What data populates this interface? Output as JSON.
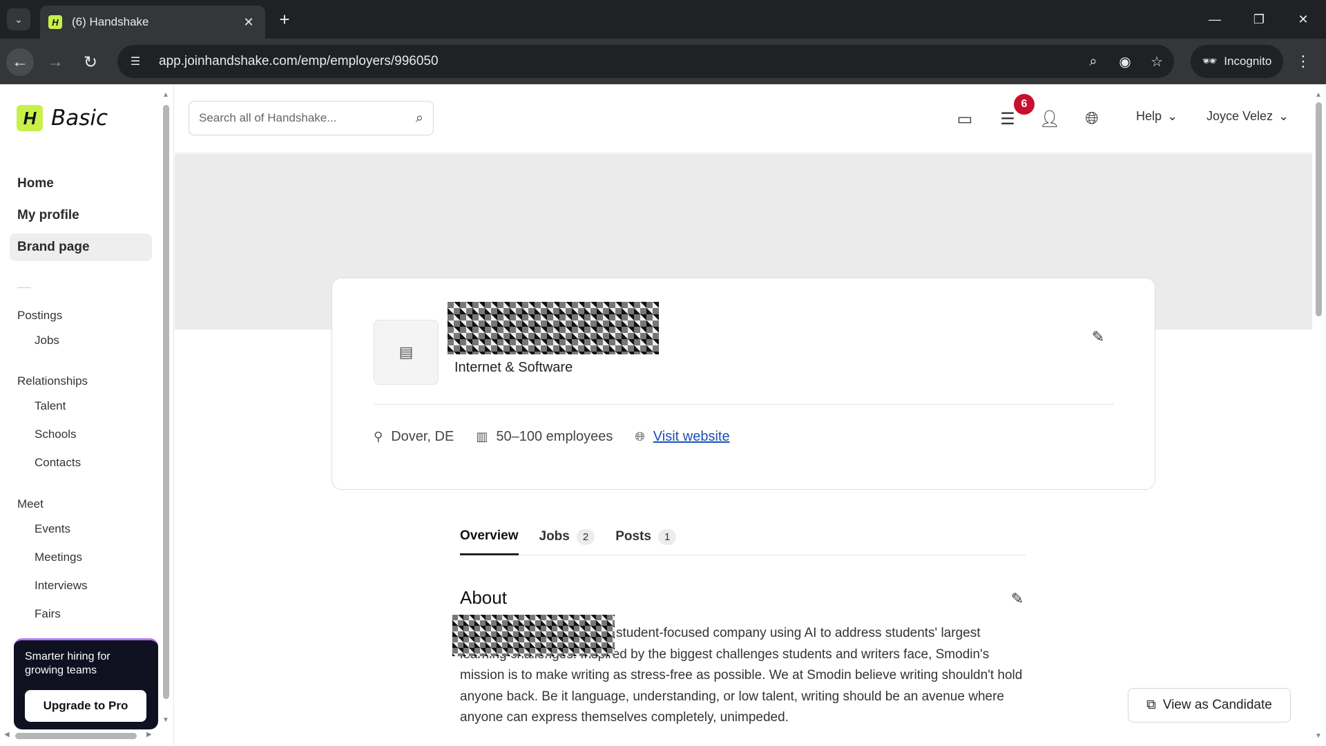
{
  "browser": {
    "tab_title": "(6) Handshake",
    "favicon_letter": "H",
    "url": "app.joinhandshake.com/emp/employers/996050",
    "incognito_label": "Incognito"
  },
  "sidebar": {
    "logo_letter": "H",
    "logo_text": "Basic",
    "main_items": [
      {
        "label": "Home"
      },
      {
        "label": "My profile"
      },
      {
        "label": "Brand page"
      }
    ],
    "groups": {
      "postings": {
        "title": "Postings",
        "items": [
          {
            "label": "Jobs"
          }
        ]
      },
      "relationships": {
        "title": "Relationships",
        "items": [
          {
            "label": "Talent"
          },
          {
            "label": "Schools"
          },
          {
            "label": "Contacts"
          }
        ]
      },
      "meet": {
        "title": "Meet",
        "items": [
          {
            "label": "Events"
          },
          {
            "label": "Meetings"
          },
          {
            "label": "Interviews"
          },
          {
            "label": "Fairs"
          }
        ]
      }
    },
    "promo": {
      "text": "Smarter hiring for growing teams",
      "button": "Upgrade to Pro"
    }
  },
  "topbar": {
    "search_placeholder": "Search all of Handshake...",
    "messages_badge": "6",
    "help_label": "Help",
    "user_name": "Joyce Velez"
  },
  "employer": {
    "industry": "Internet & Software",
    "location": "Dover, DE",
    "size": "50–100 employees",
    "website_label": "Visit website"
  },
  "tabs": [
    {
      "label": "Overview",
      "count": ""
    },
    {
      "label": "Jobs",
      "count": "2"
    },
    {
      "label": "Posts",
      "count": "1"
    }
  ],
  "about": {
    "title": "About",
    "text": "student-focused company using AI to address students' largest learning challenges. Inspired by the biggest challenges students and writers face, Smodin's mission is to make writing as stress-free as possible. We at Smodin believe writing shouldn't hold anyone back. Be it language, understanding, or low talent, writing should be an avenue where anyone can express themselves completely, unimpeded."
  },
  "view_as_candidate": "View as Candidate"
}
